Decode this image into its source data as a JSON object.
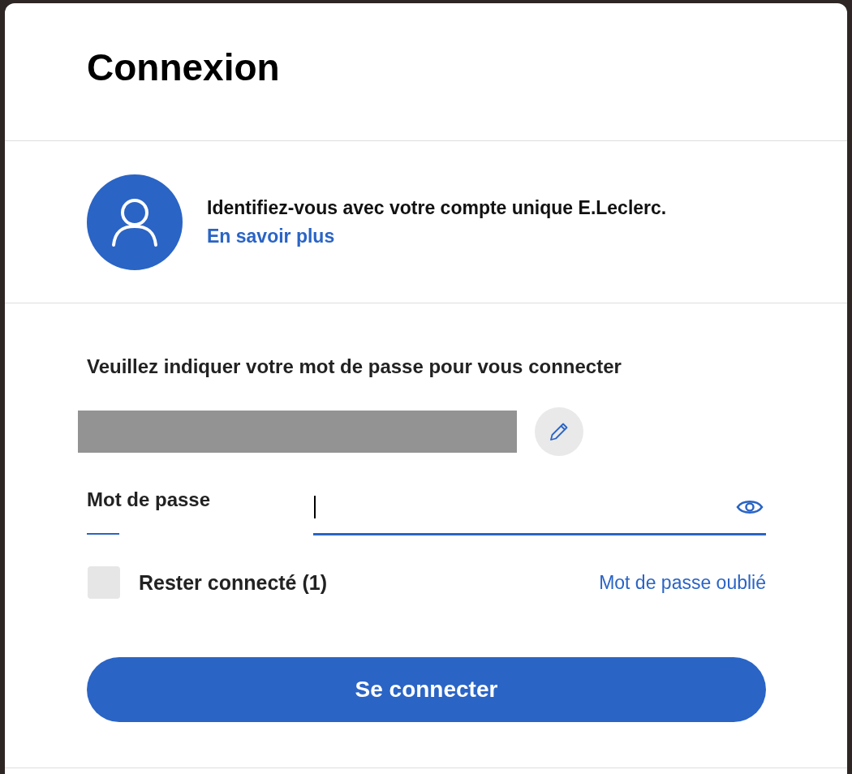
{
  "dialog": {
    "title": "Connexion"
  },
  "account_notice": {
    "text": "Identifiez-vous avec votre compte unique E.Leclerc.",
    "link": "En savoir plus"
  },
  "prompt": "Veuillez indiquer votre mot de passe pour vous connecter",
  "password": {
    "label": "Mot de passe"
  },
  "remember": {
    "label": "Rester connecté (1)",
    "checked": false
  },
  "forgot_link": "Mot de passe oublié",
  "submit": "Se connecter"
}
